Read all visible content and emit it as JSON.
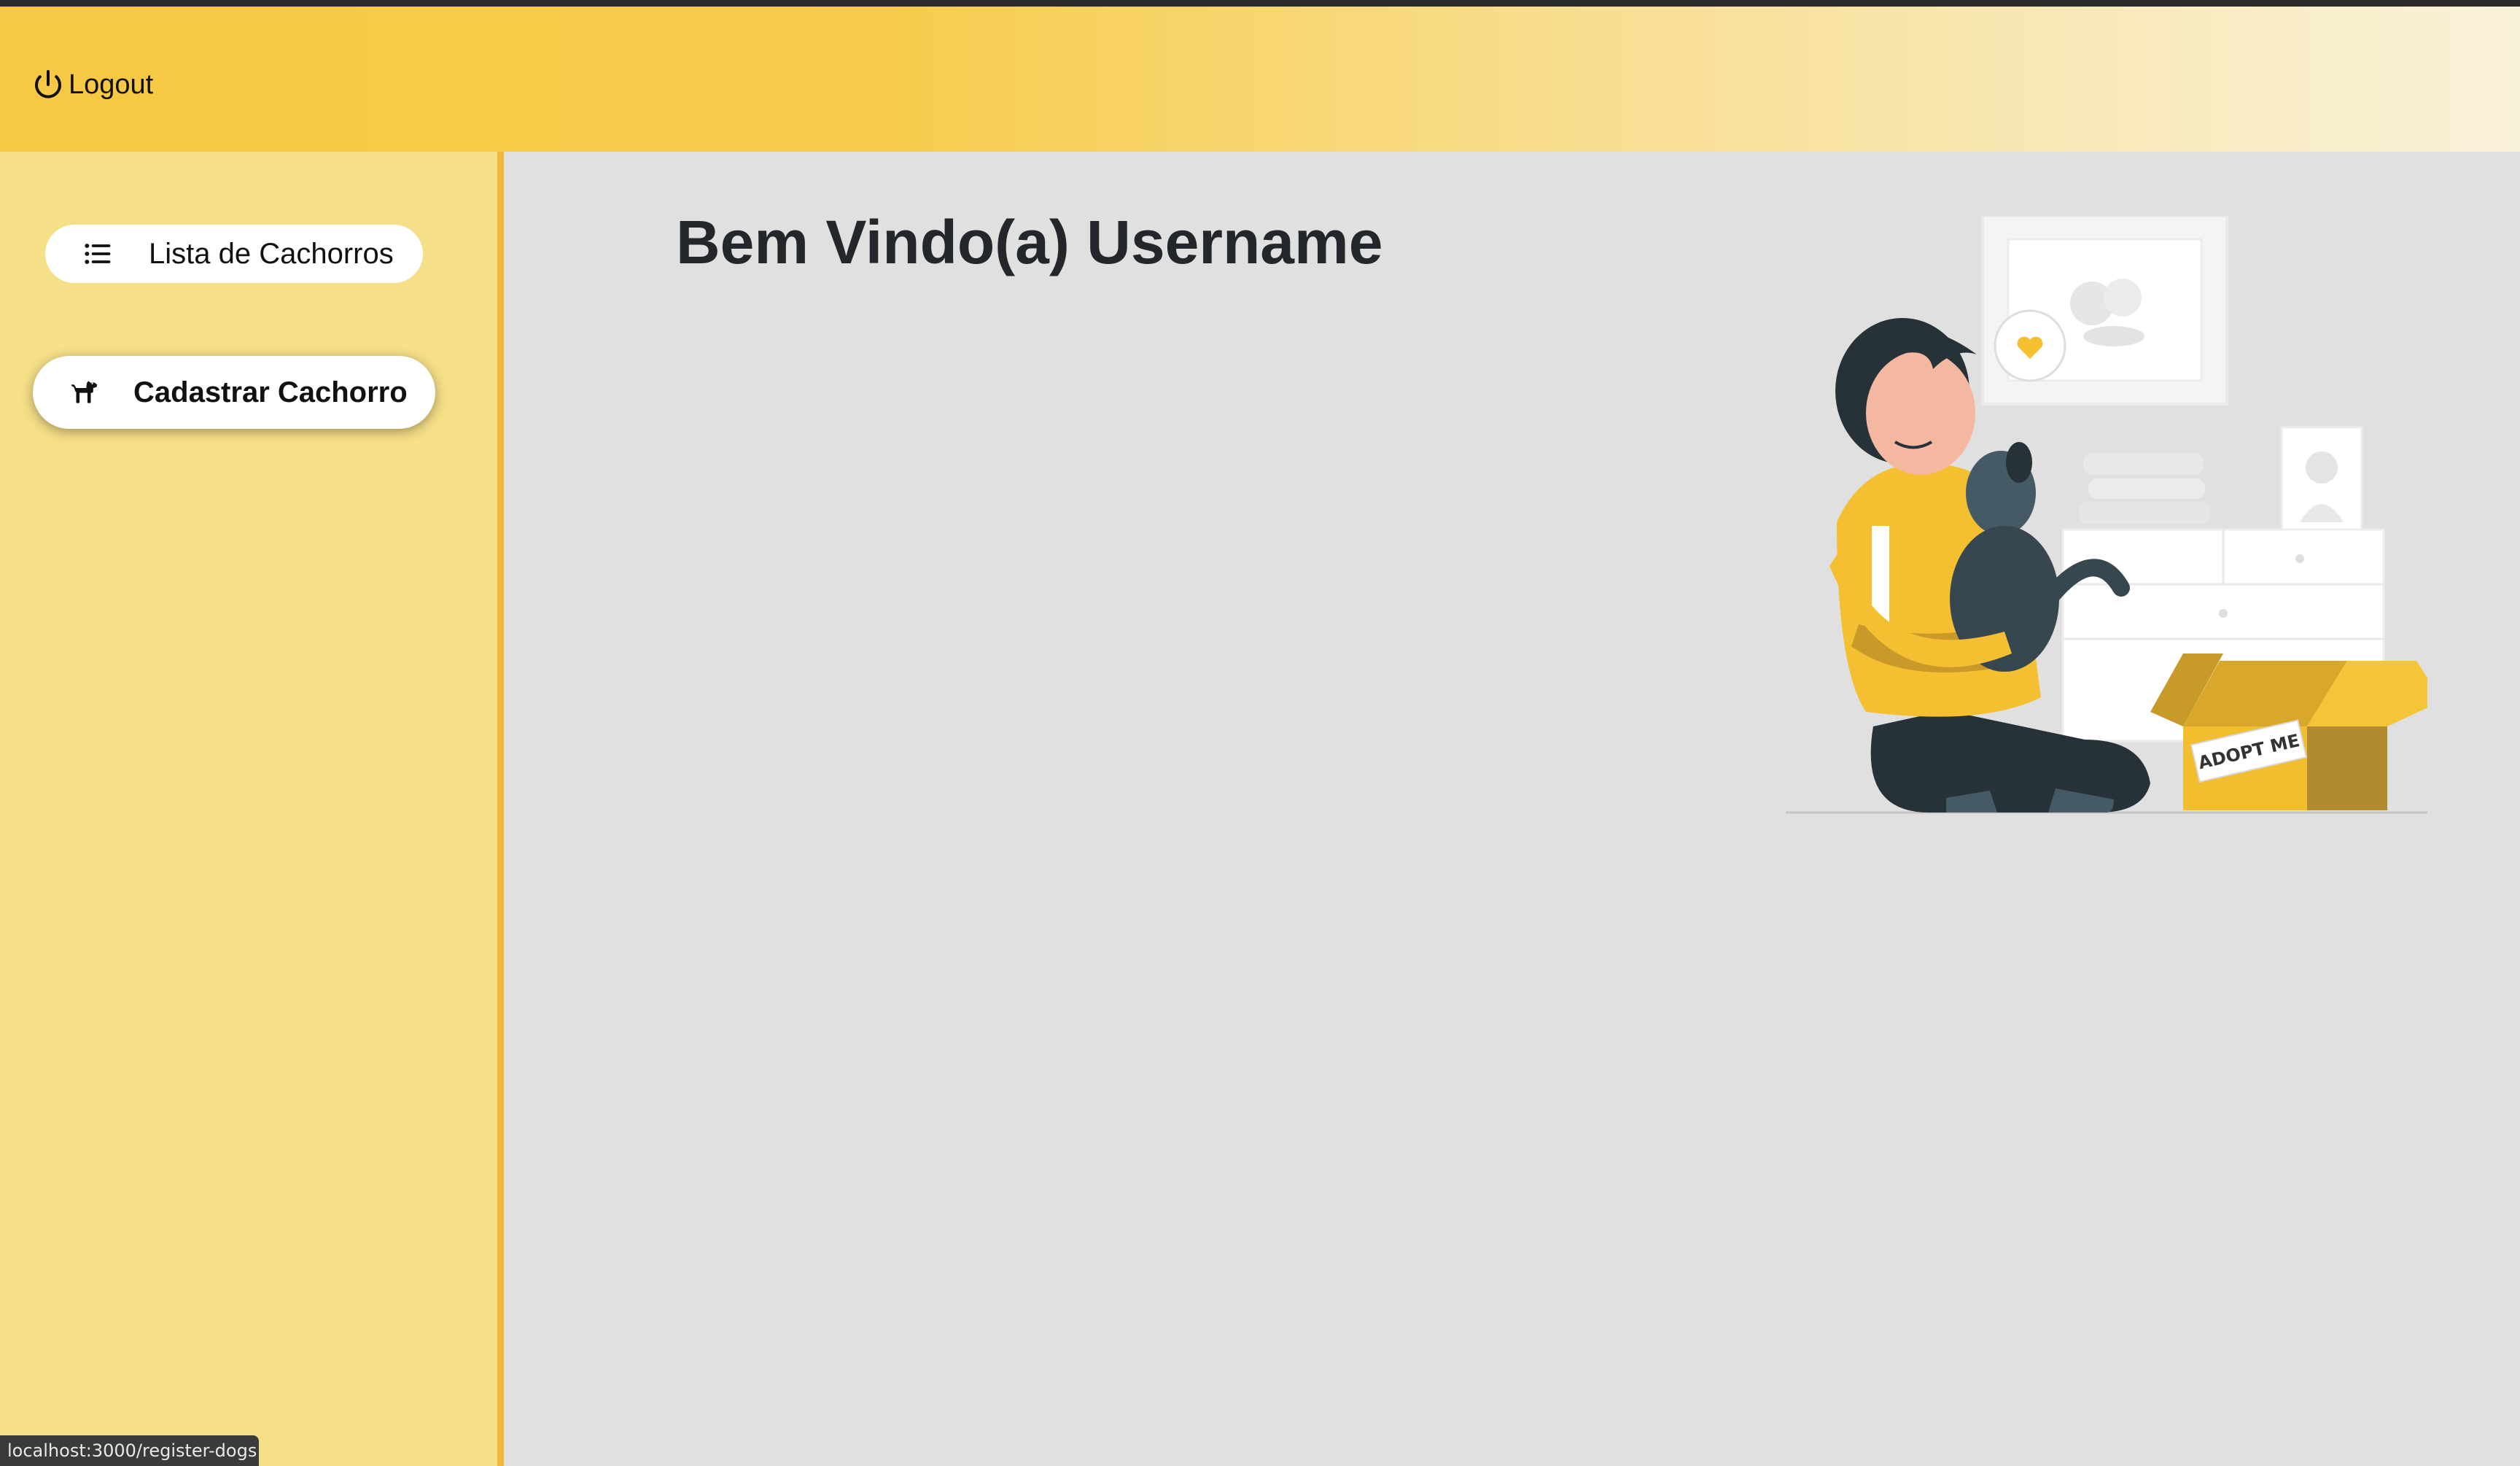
{
  "header": {
    "logout_label": "Logout",
    "logout_icon": "power-icon",
    "gradient_start": "#f7c843",
    "gradient_end": "#f9f2da"
  },
  "sidebar": {
    "background": "#f5df87",
    "border_color": "#f3b53a",
    "items": [
      {
        "label": "Lista de Cachorros",
        "icon": "list-icon",
        "active": false
      },
      {
        "label": "Cadastrar Cachorro",
        "icon": "dog-icon",
        "active": true
      }
    ]
  },
  "main": {
    "title": "Bem Vindo(a) Username",
    "illustration": {
      "box_label": "ADOPT ME"
    }
  },
  "statusbar": {
    "url": "localhost:3000/register-dogs"
  }
}
